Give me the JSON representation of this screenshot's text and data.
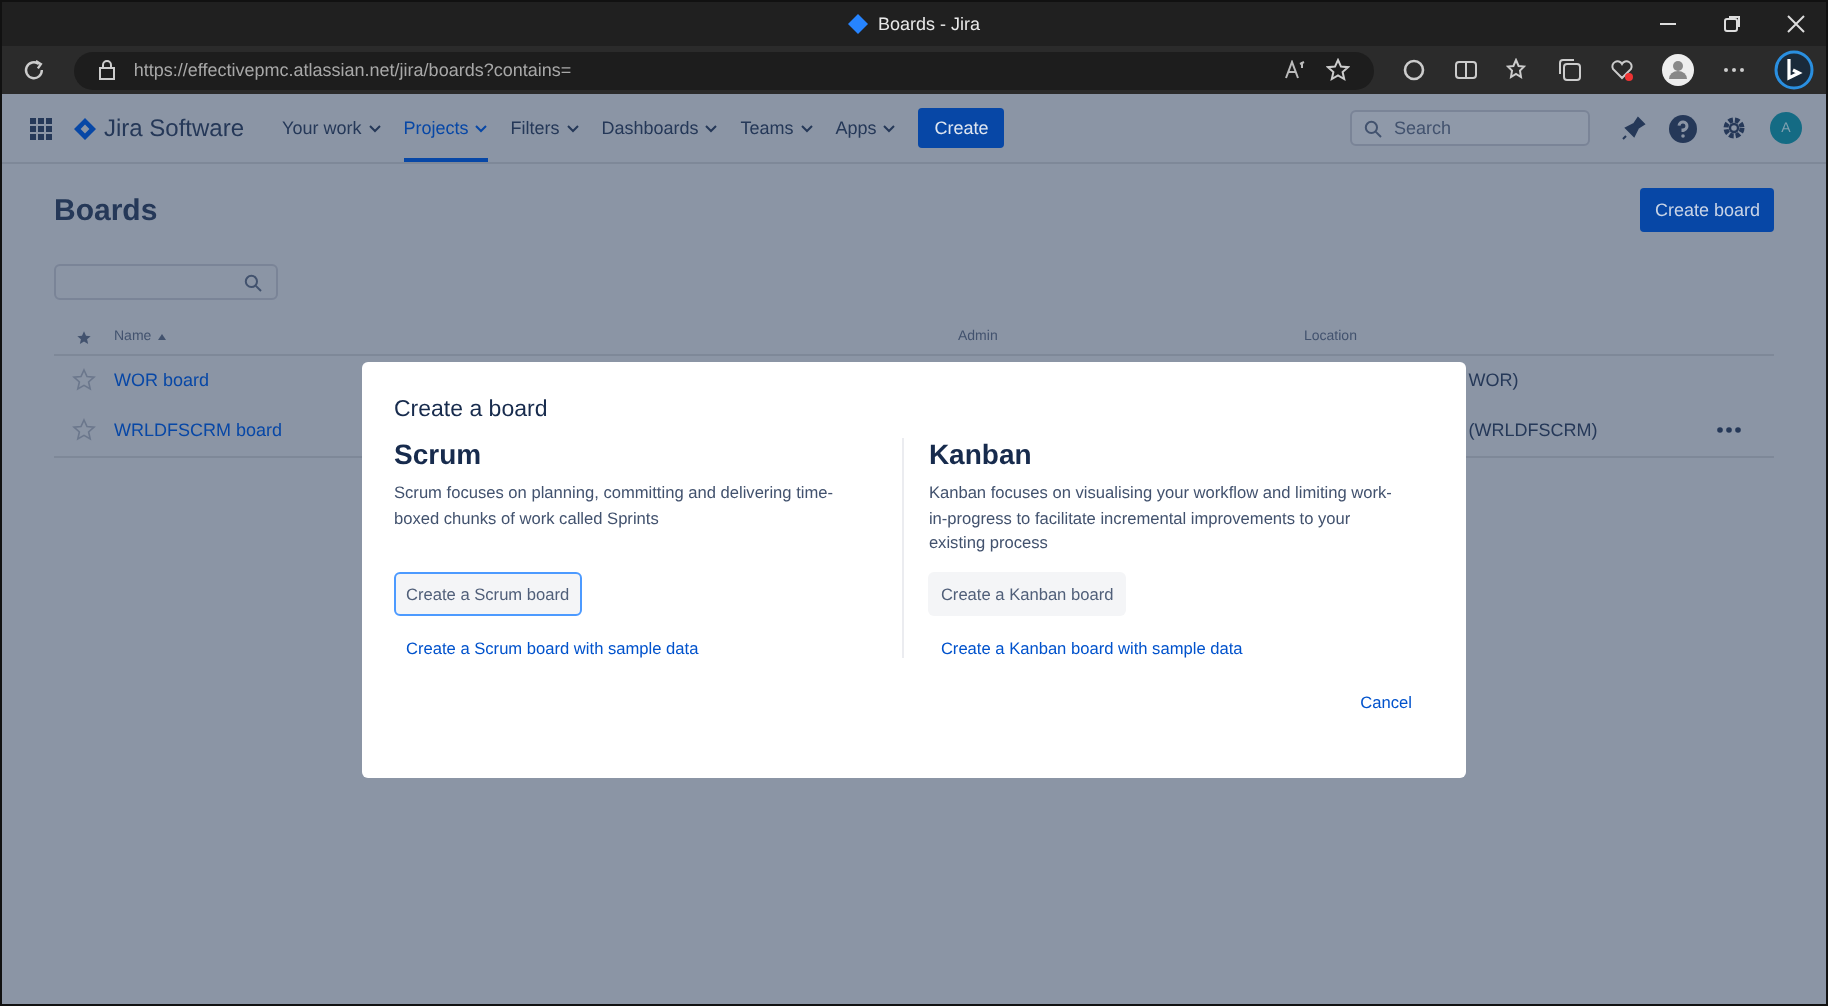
{
  "window": {
    "title": "Boards - Jira"
  },
  "address_bar": {
    "url": "https://effectivepmc.atlassian.net/jira/boards?contains="
  },
  "app_nav": {
    "product": "Jira Software",
    "items": [
      {
        "label": "Your work",
        "selected": false
      },
      {
        "label": "Projects",
        "selected": true
      },
      {
        "label": "Filters",
        "selected": false
      },
      {
        "label": "Dashboards",
        "selected": false
      },
      {
        "label": "Teams",
        "selected": false
      },
      {
        "label": "Apps",
        "selected": false
      }
    ],
    "create_button": "Create",
    "search": {
      "placeholder": "Search"
    },
    "avatar": "A"
  },
  "page": {
    "title": "Boards",
    "create_button": "Create board",
    "table": {
      "columns": [
        "Name",
        "Admin",
        "Location"
      ],
      "rows": [
        {
          "name": "WOR board",
          "location": "WOR)",
          "starred": false,
          "menu": false
        },
        {
          "name": "WRLDFSCRM board",
          "location": "(WRLDFSCRM)",
          "starred": false,
          "menu": true
        }
      ]
    }
  },
  "dialog": {
    "title": "Create a board",
    "options": [
      {
        "heading": "Scrum",
        "description": "Scrum focuses on planning, committing and delivering time-boxed chunks of work called Sprints",
        "button": "Create a Scrum board",
        "focused": true,
        "link": "Create a Scrum board with sample data"
      },
      {
        "heading": "Kanban",
        "description": "Kanban focuses on visualising your workflow and limiting work-in-progress to facilitate incremental improvements to your existing process",
        "button": "Create a Kanban board",
        "focused": false,
        "link": "Create a Kanban board with sample data"
      }
    ],
    "cancel": "Cancel"
  }
}
